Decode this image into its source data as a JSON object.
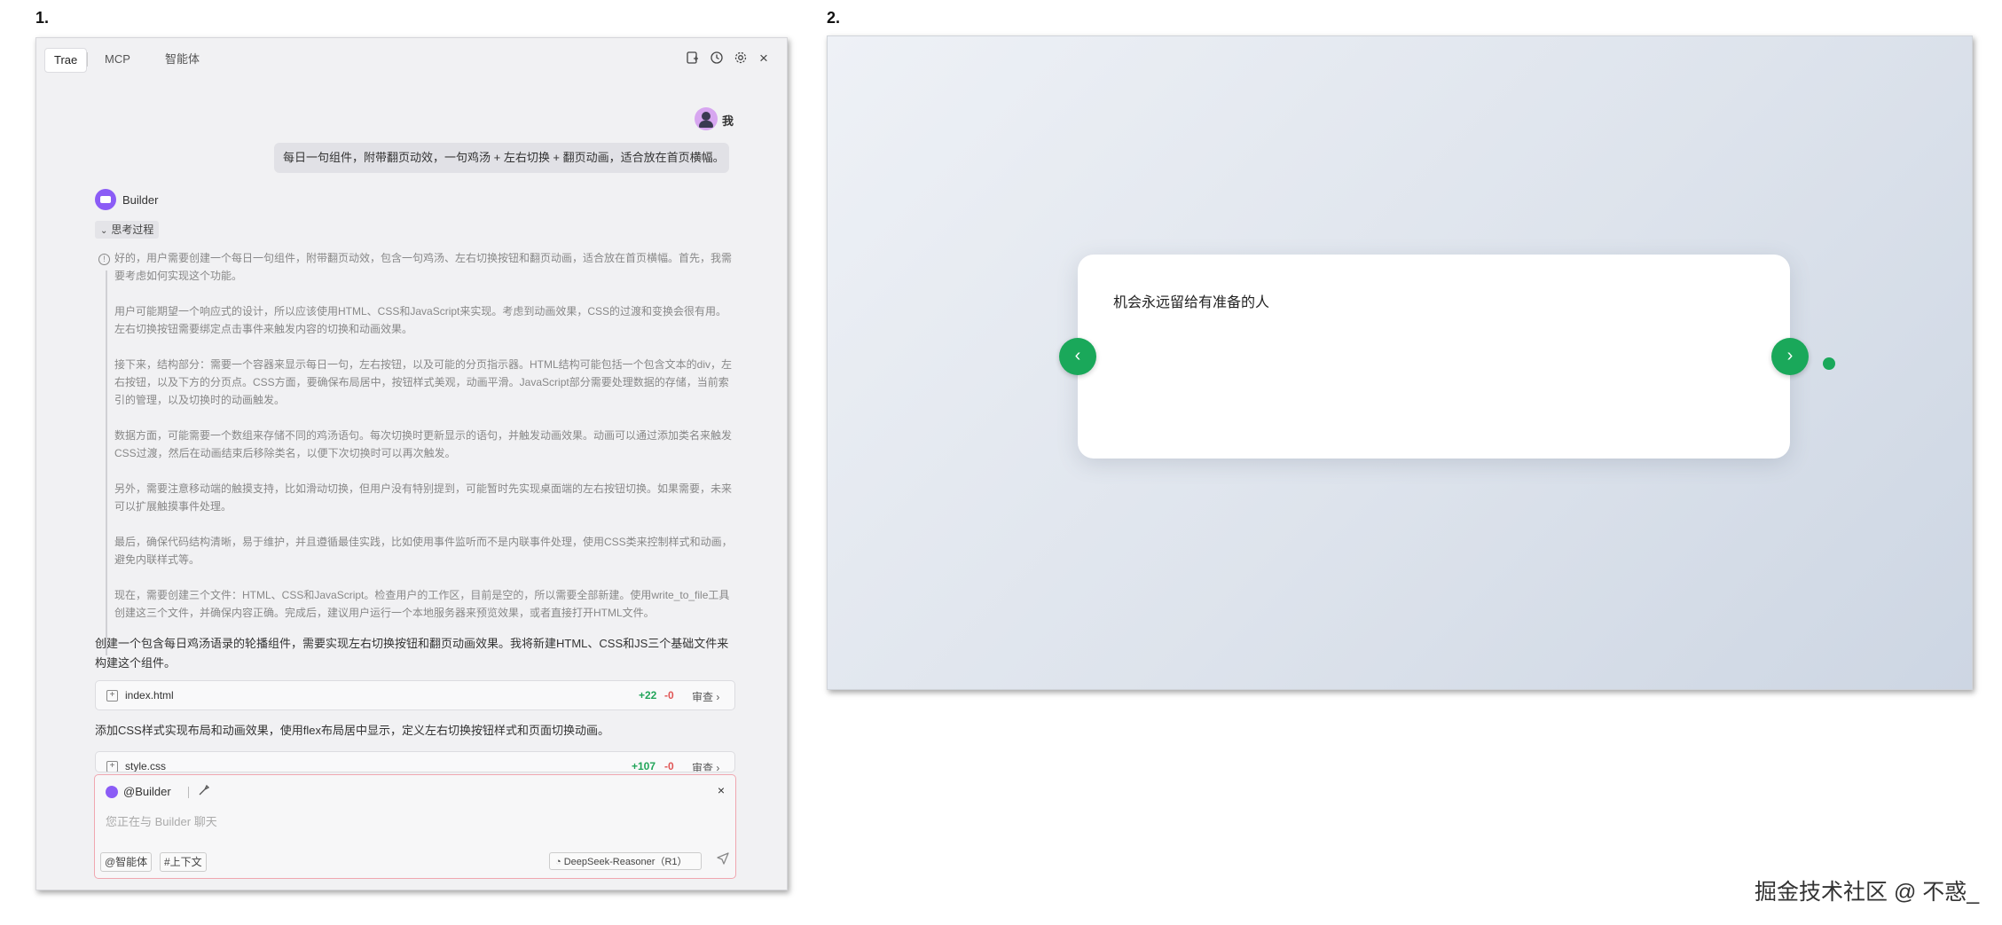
{
  "labels": {
    "fig1": "1.",
    "fig2": "2."
  },
  "ide": {
    "tabs": [
      "Trae",
      "MCP",
      "智能体"
    ],
    "header_icons": [
      "new-chat-icon",
      "history-icon",
      "settings-icon",
      "close-icon"
    ],
    "user": {
      "name": "我",
      "message": "每日一句组件，附带翻页动效，一句鸡汤 + 左右切换 + 翻页动画，适合放在首页横幅。"
    },
    "assistant": {
      "name": "Builder",
      "thinking_label": "思考过程",
      "thinking": [
        "好的，用户需要创建一个每日一句组件，附带翻页动效，包含一句鸡汤、左右切换按钮和翻页动画，适合放在首页横幅。首先，我需要考虑如何实现这个功能。",
        "用户可能期望一个响应式的设计，所以应该使用HTML、CSS和JavaScript来实现。考虑到动画效果，CSS的过渡和变换会很有用。左右切换按钮需要绑定点击事件来触发内容的切换和动画效果。",
        "接下来，结构部分：需要一个容器来显示每日一句，左右按钮，以及可能的分页指示器。HTML结构可能包括一个包含文本的div，左右按钮，以及下方的分页点。CSS方面，要确保布局居中，按钮样式美观，动画平滑。JavaScript部分需要处理数据的存储，当前索引的管理，以及切换时的动画触发。",
        "数据方面，可能需要一个数组来存储不同的鸡汤语句。每次切换时更新显示的语句，并触发动画效果。动画可以通过添加类名来触发CSS过渡，然后在动画结束后移除类名，以便下次切换时可以再次触发。",
        "另外，需要注意移动端的触摸支持，比如滑动切换，但用户没有特别提到，可能暂时先实现桌面端的左右按钮切换。如果需要，未来可以扩展触摸事件处理。",
        "最后，确保代码结构清晰，易于维护，并且遵循最佳实践，比如使用事件监听而不是内联事件处理，使用CSS类来控制样式和动画，避免内联样式等。",
        "现在，需要创建三个文件：HTML、CSS和JavaScript。检查用户的工作区，目前是空的，所以需要全部新建。使用write_to_file工具创建这三个文件，并确保内容正确。完成后，建议用户运行一个本地服务器来预览效果，或者直接打开HTML文件。"
      ],
      "response_1": "创建一个包含每日鸡汤语录的轮播组件，需要实现左右切换按钮和翻页动画效果。我将新建HTML、CSS和JS三个基础文件来构建这个组件。",
      "file_1": {
        "name": "index.html",
        "added": "+22",
        "removed": "-0",
        "action": "审查"
      },
      "response_2": "添加CSS样式实现布局和动画效果，使用flex布局居中显示，定义左右切换按钮样式和页面切换动画。",
      "file_2": {
        "name": "style.css",
        "added": "+107",
        "removed": "-0",
        "action": "审查"
      }
    },
    "input": {
      "agent": "@Builder",
      "placeholder": "您正在与 Builder 聊天",
      "chip_agent": "@智能体",
      "chip_context": "#上下文",
      "model": "DeepSeek-Reasoner（R1）"
    }
  },
  "preview": {
    "quote": "机会永远留给有准备的人",
    "prev": "‹",
    "next": "›",
    "accent": "#1aa85a"
  },
  "watermark": "掘金技术社区 @ 不惑_"
}
